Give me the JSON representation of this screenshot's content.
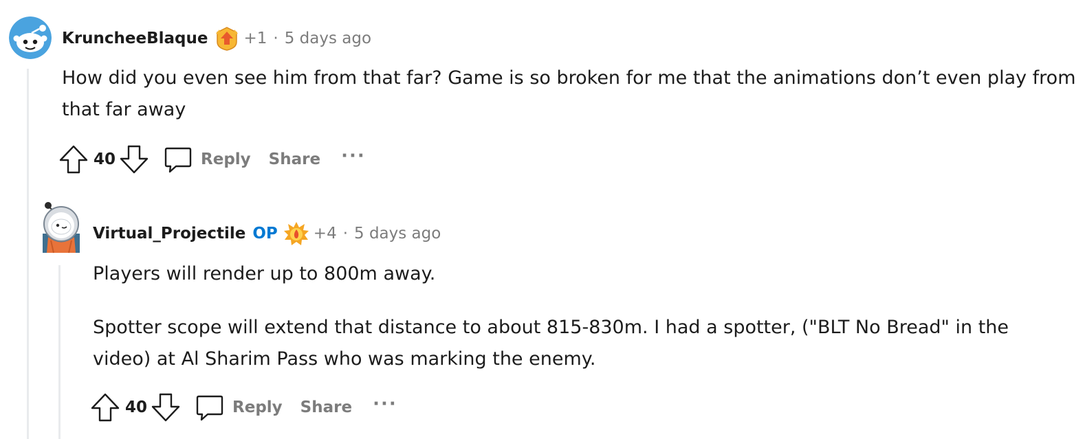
{
  "comments": [
    {
      "username": "KruncheeBlaque",
      "op_label": "",
      "flair_count": "+1",
      "separator": "·",
      "timestamp": "5 days ago",
      "body": [
        "How did you even see him from that far? Game is so broken for me that the animations don’t even play from that far away"
      ],
      "score": "40",
      "reply_label": "Reply",
      "share_label": "Share",
      "more_label": "···",
      "avatar_icon": "snoo-avatar-icon",
      "flair_icon": "upvote-award-icon",
      "flair_color": "#e85a2c"
    },
    {
      "username": "Virtual_Projectile",
      "op_label": "OP",
      "flair_count": "+4",
      "separator": "·",
      "timestamp": "5 days ago",
      "body": [
        "Players will render up to 800m away.",
        "Spotter scope will extend that distance to about 815-830m. I had a spotter, (\"BLT No Bread\" in the video) at Al Sharim Pass who was marking the enemy."
      ],
      "score": "40",
      "reply_label": "Reply",
      "share_label": "Share",
      "more_label": "···",
      "avatar_icon": "astronaut-snoo-avatar-icon",
      "flair_icon": "fire-award-icon",
      "flair_color": "#f5a623"
    }
  ],
  "colors": {
    "text": "#1c1c1c",
    "muted": "#7c7c7c",
    "op": "#0079d3",
    "thread_line": "#e9ebed",
    "avatar_blue": "#4aa3df"
  }
}
